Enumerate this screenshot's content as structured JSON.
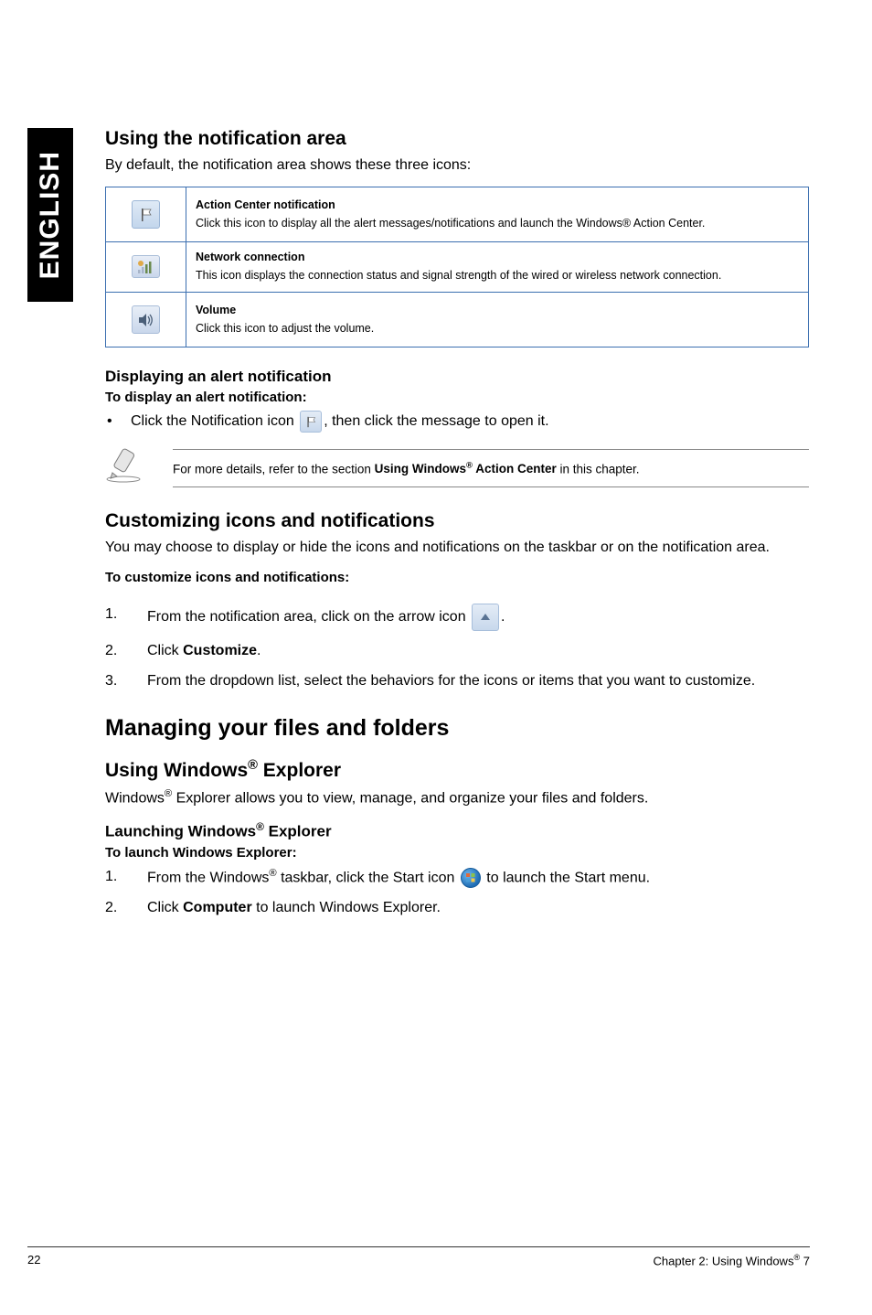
{
  "sideTab": "ENGLISH",
  "section1": {
    "heading": "Using the notification area",
    "intro": "By default, the notification area shows these three icons:",
    "rows": [
      {
        "title": "Action Center notification",
        "desc": "Click this icon to display all the alert messages/notifications and launch the Windows® Action Center."
      },
      {
        "title": "Network connection",
        "desc": "This icon displays the connection status and signal strength of the wired or wireless network connection."
      },
      {
        "title": "Volume",
        "desc": "Click this icon to adjust the volume."
      }
    ]
  },
  "section2": {
    "heading": "Displaying an alert notification",
    "sub": "To display an alert notification:",
    "bullet_pre": "Click the Notification icon ",
    "bullet_post": ", then click the message to open it."
  },
  "note": {
    "pre": "For more details, refer to the section ",
    "bold": "Using Windows® Action Center",
    "post": " in this chapter."
  },
  "section3": {
    "heading": "Customizing icons and notifications",
    "intro": "You may choose to display or hide the icons and notifications on the taskbar or on the notification area.",
    "sub": "To customize icons and notifications:",
    "steps": {
      "s1_pre": "From the notification area, click on the arrow icon ",
      "s1_post": ".",
      "s2_pre": "Click ",
      "s2_bold": "Customize",
      "s2_post": ".",
      "s3": "From the dropdown list, select the behaviors for the icons or items that you want to customize."
    }
  },
  "section4": {
    "bigHeading": "Managing your files and folders",
    "subHeading": "Using Windows® Explorer",
    "intro": "Windows® Explorer allows you to view, manage, and organize your files and folders.",
    "launchHeading": "Launching Windows® Explorer",
    "launchSub": "To launch Windows Explorer:",
    "steps": {
      "s1_pre": "From the Windows® taskbar, click the Start icon ",
      "s1_post": " to launch the Start menu.",
      "s2_pre": "Click ",
      "s2_bold": "Computer",
      "s2_post": " to launch Windows Explorer."
    }
  },
  "footer": {
    "left": "22",
    "right": "Chapter 2: Using Windows® 7"
  }
}
